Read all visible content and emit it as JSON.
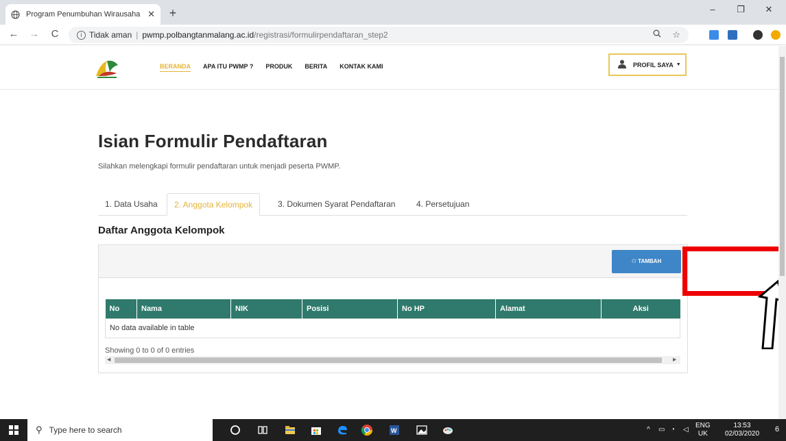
{
  "browser": {
    "tab_title": "Program Penumbuhan Wirausaha",
    "tab_close": "✕",
    "new_tab": "+",
    "minimize": "–",
    "restore": "❐",
    "close": "✕",
    "back": "←",
    "forward": "→",
    "reload": "C",
    "security_label": "Tidak aman",
    "url_host": "pwmp.polbangtanmalang.ac.id",
    "url_path": "/registrasi/formulirpendaftaran_step2",
    "zoom_icon": "zoom-icon",
    "star_icon": "star-icon"
  },
  "header": {
    "nav": [
      "BERANDA",
      "APA ITU PWMP ?",
      "PRODUK",
      "BERITA",
      "KONTAK KAMI"
    ],
    "profile_label": "PROFIL SAYA"
  },
  "main": {
    "title": "Isian Formulir Pendaftaran",
    "subtitle": "Silahkan melengkapi formulir pendaftaran untuk menjadi peserta PWMP.",
    "tabs": [
      "1. Data Usaha",
      "2. Anggota Kelompok",
      "3. Dokumen Syarat Pendaftaran",
      "4. Persetujuan"
    ],
    "active_tab": 1,
    "section_title": "Daftar Anggota Kelompok",
    "add_button": "TAMBAH",
    "table": {
      "columns": [
        "No",
        "Nama",
        "NIK",
        "Posisi",
        "No HP",
        "Alamat",
        "Aksi"
      ],
      "empty_text": "No data available in table"
    },
    "showing": "Showing 0 to 0 of 0 entries"
  },
  "taskbar": {
    "search_placeholder": "Type here to search",
    "lang_top": "ENG",
    "lang_bottom": "UK",
    "time": "13:53",
    "date": "02/03/2020",
    "notif_count": "6"
  },
  "colors": {
    "accent_gold": "#e5b43a",
    "table_header": "#2f7a6c",
    "button_blue": "#3e86c7",
    "annotation_red": "#ee0000"
  }
}
